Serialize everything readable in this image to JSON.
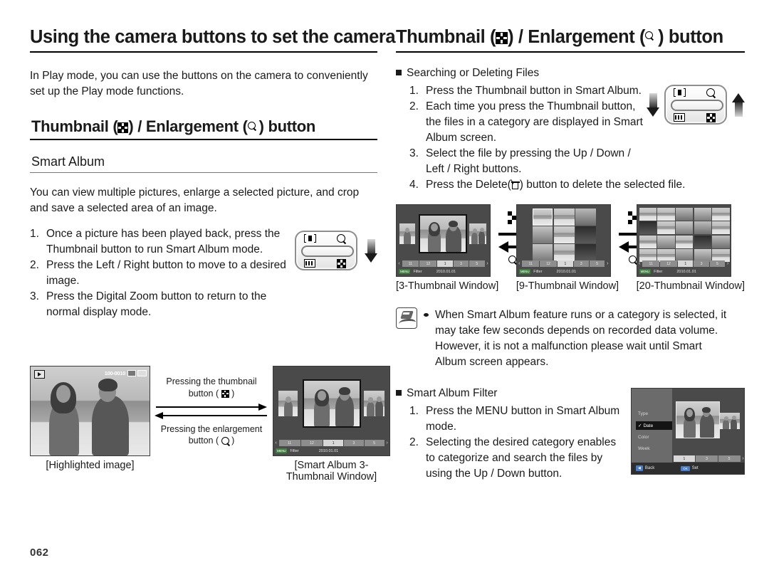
{
  "page_number": "062",
  "left": {
    "heading_main": "Using the camera buttons to set the camera",
    "intro": "In Play mode, you can use the buttons on the camera to conveniently set up the Play mode functions.",
    "heading_sub_pre": "Thumbnail (",
    "heading_sub_mid": ") / Enlargement (",
    "heading_sub_post": ") button",
    "smart_album_title": "Smart Album",
    "smart_album_desc": "You can view multiple pictures, enlarge a selected picture, and crop and save a selected area of an image.",
    "steps": [
      {
        "num": "1.",
        "text": "Once a picture has been played back, press the Thumbnail button to run Smart Album mode."
      },
      {
        "num": "2.",
        "text": "Press the Left / Right button to move to a desired image."
      },
      {
        "num": "3.",
        "text": "Press the Digital Zoom button to return to the normal display mode."
      }
    ],
    "arrow_top_line1": "Pressing the thumbnail",
    "arrow_top_line2_pre": "button (",
    "arrow_top_line2_post": ")",
    "arrow_bottom_line1": "Pressing the enlargement",
    "arrow_bottom_line2_pre": "button (",
    "arrow_bottom_line2_post": ")",
    "caption_highlighted": "[Highlighted image]",
    "caption_smart_album": "[Smart Album 3-Thumbnail Window]",
    "lcd_osd": {
      "file_number": "100-0010"
    }
  },
  "right": {
    "heading_main_pre": "Thumbnail (",
    "heading_main_mid": ") / Enlargement (",
    "heading_main_post": ") button",
    "section1_title": "Searching or Deleting Files",
    "section1_steps": [
      {
        "num": "1.",
        "text": "Press the Thumbnail button in Smart Album."
      },
      {
        "num": "2.",
        "text": "Each time you press the Thumbnail button, the files in a category are displayed in Smart Album screen."
      },
      {
        "num": "3.",
        "text": "Select the file by pressing the Up / Down / Left / Right buttons."
      }
    ],
    "step4_pre": "4.",
    "step4_a": "Press the Delete(",
    "step4_b": ") button to delete the selected file.",
    "captions": [
      "[3-Thumbnail Window]",
      "[9-Thumbnail Window]",
      "[20-Thumbnail Window]"
    ],
    "note": "When Smart Album feature runs or a category is selected, it may take few seconds depends on recorded data volume. However, it is not a malfunction please wait until Smart Album screen appears.",
    "section2_title": "Smart Album Filter",
    "section2_steps": [
      {
        "num": "1.",
        "text": "Press the MENU button in Smart Album mode."
      },
      {
        "num": "2.",
        "text": "Selecting the desired category enables to categorize and search the files by using the Up / Down button."
      }
    ],
    "filter_menu": {
      "items": [
        "Type",
        "Date",
        "Color",
        "Week"
      ],
      "selected": "Date",
      "check_glyph": "✓",
      "back_label": "Back",
      "set_label": "Set",
      "ok_label": "OK"
    }
  },
  "lcd_common": {
    "filmstrip": [
      "11",
      "12",
      "1",
      "3",
      "5"
    ],
    "filmstrip_selected": "1",
    "left_cap": "‹",
    "right_cap": "›",
    "menu_chip": "MENU",
    "filter_label": "Filter",
    "date": "2010.01.01"
  },
  "icons": {
    "thumbnail": "thumbnail-grid-icon",
    "enlargement": "magnifier-icon",
    "delete": "trash-icon",
    "note": "note-pen-icon",
    "zoom_wide": "zoom-wide-icon",
    "zoom_film": "filmstrip-icon"
  },
  "colors": {
    "text": "#1a1a1a",
    "rule": "#000000",
    "lcd_bg": "#4a4a4a",
    "menu_chip": "#3f7f3f",
    "highlight": "#141414"
  }
}
